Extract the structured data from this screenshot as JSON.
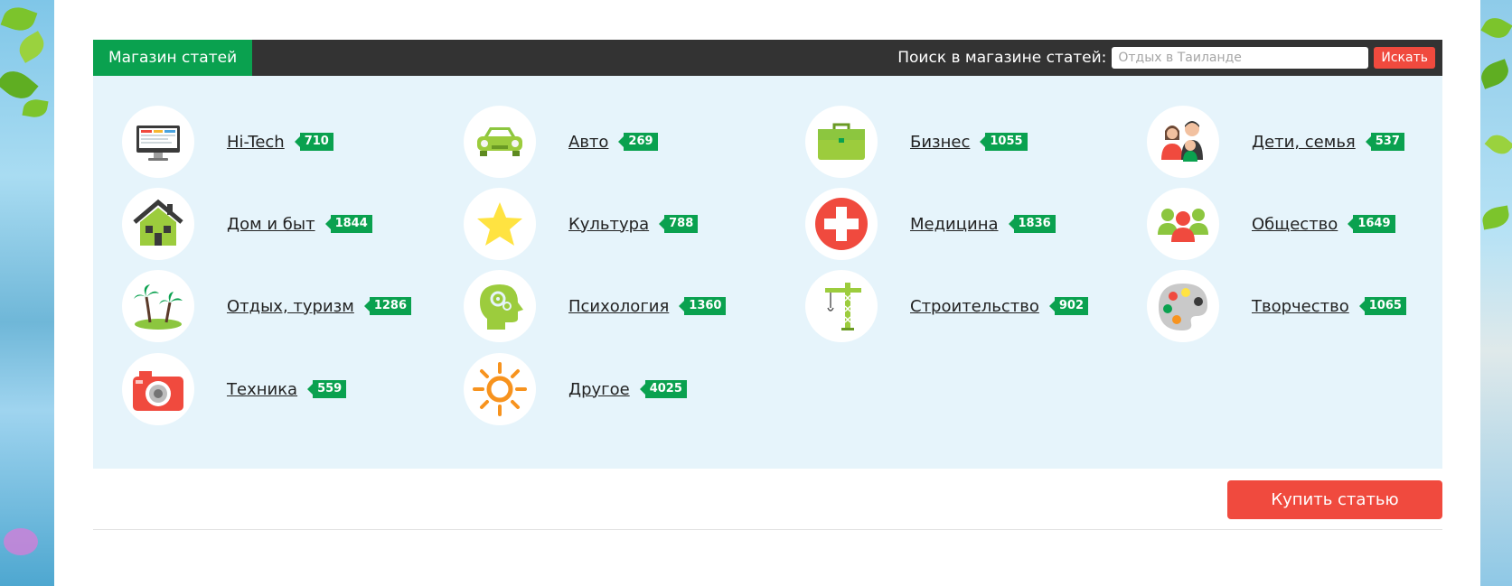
{
  "shop": {
    "title": "Магазин статей",
    "search_label": "Поиск в магазине статей:",
    "search_placeholder": "Отдых в Таиланде",
    "search_button": "Искать",
    "buy_button": "Купить статью"
  },
  "categories": [
    {
      "label": "Hi-Tech",
      "count": "710",
      "icon": "computer-icon"
    },
    {
      "label": "Авто",
      "count": "269",
      "icon": "car-icon"
    },
    {
      "label": "Бизнес",
      "count": "1055",
      "icon": "briefcase-icon"
    },
    {
      "label": "Дети, семья",
      "count": "537",
      "icon": "family-icon"
    },
    {
      "label": "Дом и быт",
      "count": "1844",
      "icon": "house-icon"
    },
    {
      "label": "Культура",
      "count": "788",
      "icon": "star-icon"
    },
    {
      "label": "Медицина",
      "count": "1836",
      "icon": "medical-cross-icon"
    },
    {
      "label": "Общество",
      "count": "1649",
      "icon": "people-icon"
    },
    {
      "label": "Отдых, туризм",
      "count": "1286",
      "icon": "palm-island-icon"
    },
    {
      "label": "Психология",
      "count": "1360",
      "icon": "head-gears-icon"
    },
    {
      "label": "Строительство",
      "count": "902",
      "icon": "crane-icon"
    },
    {
      "label": "Творчество",
      "count": "1065",
      "icon": "palette-icon"
    },
    {
      "label": "Техника",
      "count": "559",
      "icon": "camera-icon"
    },
    {
      "label": "Другое",
      "count": "4025",
      "icon": "sun-icon"
    }
  ],
  "colors": {
    "accent_green": "#0aa14f",
    "accent_red": "#f04a3e",
    "panel_bg": "#e6f4fb",
    "bar_bg": "#333333"
  }
}
